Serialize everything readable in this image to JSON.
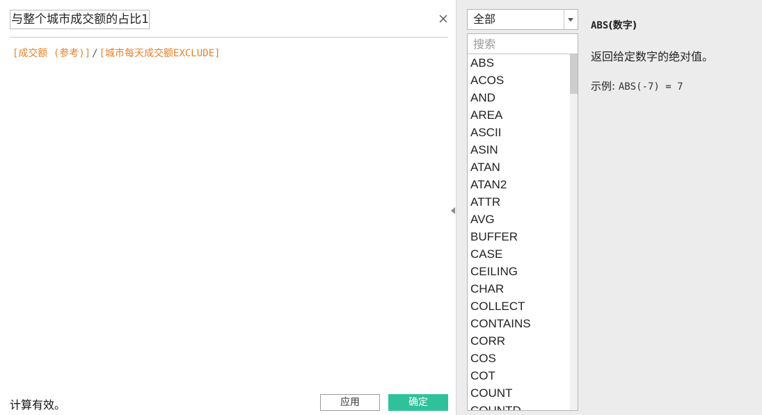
{
  "editor": {
    "calc_name": "与整个城市成交额的占比1",
    "formula": {
      "field1": "[成交额 (参考)]",
      "operator": "/",
      "field2": "[城市每天成交额EXCLUDE]",
      "field_color": "#e8812b"
    },
    "status": "计算有效。",
    "apply_label": "应用",
    "ok_label": "确定",
    "ok_color": "#2fc29a"
  },
  "functions": {
    "category_selected": "全部",
    "search_placeholder": "搜索",
    "items": [
      "ABS",
      "ACOS",
      "AND",
      "AREA",
      "ASCII",
      "ASIN",
      "ATAN",
      "ATAN2",
      "ATTR",
      "AVG",
      "BUFFER",
      "CASE",
      "CEILING",
      "CHAR",
      "COLLECT",
      "CONTAINS",
      "CORR",
      "COS",
      "COT",
      "COUNT",
      "COUNTD"
    ]
  },
  "description": {
    "name": "ABS",
    "signature_rest": "(数字)",
    "body": "返回给定数字的绝对值。",
    "example_label": "示例: ",
    "example_code": "ABS(-7) = 7"
  },
  "icons": {
    "close": "close-icon",
    "collapse": "collapse-left-icon",
    "dropdown": "chevron-down-icon"
  }
}
